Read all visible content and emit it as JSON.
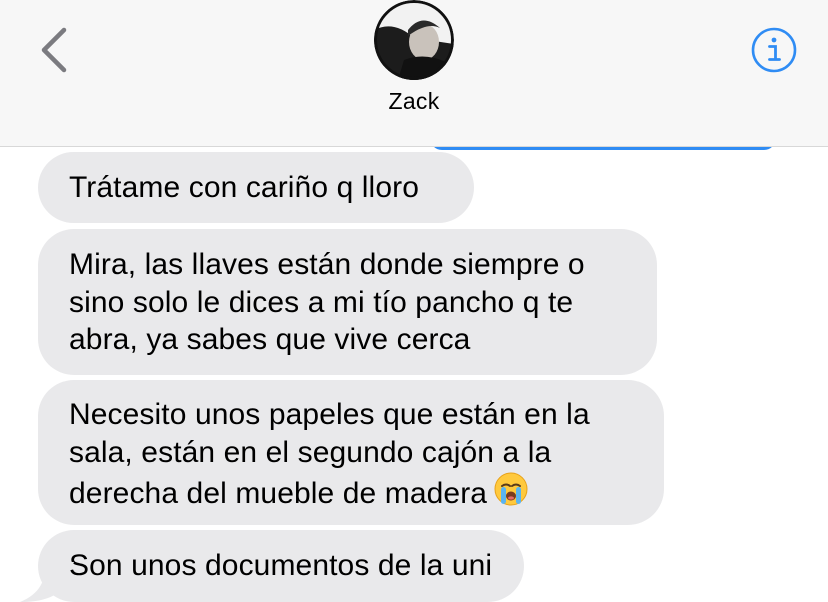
{
  "header": {
    "contact_name": "Zack"
  },
  "messages": [
    {
      "lines": [
        "Trátame con cariño q lloro"
      ]
    },
    {
      "lines": [
        "Mira, las llaves están donde siempre o",
        "sino solo le dices a mi tío pancho q te",
        "abra, ya sabes que vive cerca"
      ]
    },
    {
      "lines": [
        "Necesito unos papeles que están en la",
        "sala, están en el segundo cajón a la",
        "derecha del mueble de madera"
      ],
      "emoji": "loudly-crying-face"
    },
    {
      "lines": [
        "Son unos documentos de la uni"
      ]
    }
  ],
  "colors": {
    "ios_blue": "#2f8cf4",
    "received_bubble": "#e9e9eb",
    "header_background": "#f7f7f7"
  }
}
